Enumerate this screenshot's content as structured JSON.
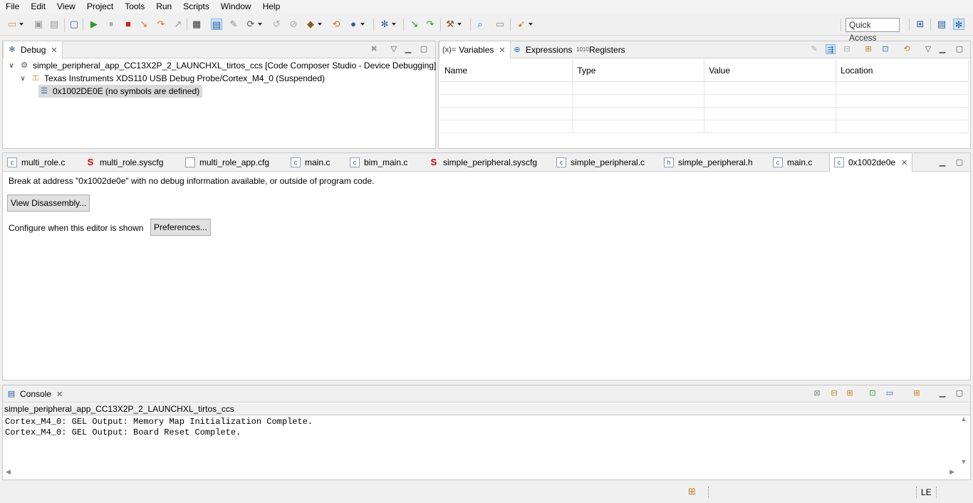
{
  "menu": [
    "File",
    "Edit",
    "View",
    "Project",
    "Tools",
    "Run",
    "Scripts",
    "Window",
    "Help"
  ],
  "toolbar": {
    "quick_access": "Quick Access"
  },
  "debug_view": {
    "tab_label": "Debug",
    "tree": {
      "project": "simple_peripheral_app_CC13X2P_2_LAUNCHXL_tirtos_ccs [Code Composer Studio - Device Debugging]",
      "target": "Texas Instruments XDS110 USB Debug Probe/Cortex_M4_0 (Suspended)",
      "frame": "0x1002DE0E  (no symbols are defined)"
    }
  },
  "variables_view": {
    "tabs": [
      {
        "icon": "(x)=",
        "label": "Variables"
      },
      {
        "icon": "⊕",
        "label": "Expressions"
      },
      {
        "icon": "1010",
        "label": "Registers"
      }
    ],
    "columns": [
      "Name",
      "Type",
      "Value",
      "Location"
    ]
  },
  "editor": {
    "tabs": [
      {
        "icon": "c",
        "label": "multi_role.c"
      },
      {
        "icon": "S",
        "label": "multi_role.syscfg"
      },
      {
        "icon": "doc",
        "label": "multi_role_app.cfg"
      },
      {
        "icon": "c",
        "label": "main.c"
      },
      {
        "icon": "c",
        "label": "bim_main.c"
      },
      {
        "icon": "S",
        "label": "simple_peripheral.syscfg"
      },
      {
        "icon": "c",
        "label": "simple_peripheral.c"
      },
      {
        "icon": "h",
        "label": "simple_peripheral.h"
      },
      {
        "icon": "c",
        "label": "main.c"
      },
      {
        "icon": "c",
        "label": "0x1002de0e"
      }
    ],
    "message": "Break at address \"0x1002de0e\" with no debug information available, or outside of program code.",
    "view_disassembly_button": "View Disassembly...",
    "configure_text": "Configure when this editor is shown",
    "preferences_button": "Preferences..."
  },
  "console": {
    "tab_label": "Console",
    "process": "simple_peripheral_app_CC13X2P_2_LAUNCHXL_tirtos_ccs",
    "lines": [
      "Cortex_M4_0: GEL Output: Memory Map Initialization Complete.",
      "Cortex_M4_0: GEL Output: Board Reset Complete."
    ]
  },
  "status": {
    "encoding": "LE"
  }
}
